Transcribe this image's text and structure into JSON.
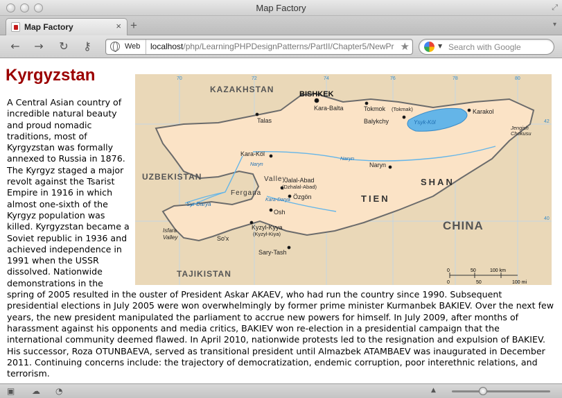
{
  "window": {
    "title": "Map Factory"
  },
  "tab": {
    "label": "Map Factory",
    "close": "×"
  },
  "toolbar": {
    "new_tab": "+",
    "tab_menu": "⌄",
    "back": "←",
    "forward": "→",
    "reload": "↻",
    "key": "⚷"
  },
  "urlbar": {
    "scheme_label": "Web",
    "host": "localhost",
    "path": "/php/LearningPHPDesignPatterns/PartII/Chapter5/NewPr"
  },
  "search": {
    "placeholder": "Search with Google"
  },
  "page": {
    "title": "Kyrgyzstan",
    "body": "A Central Asian country of incredible natural beauty and proud nomadic traditions, most of Kyrgyzstan was formally annexed to Russia in 1876. The Kyrgyz staged a major revolt against the Tsarist Empire in 1916 in which almost one-sixth of the Kyrgyz population was killed. Kyrgyzstan became a Soviet republic in 1936 and achieved independence in 1991 when the USSR dissolved. Nationwide demonstrations in the spring of 2005 resulted in the ouster of President Askar AKAEV, who had run the country since 1990. Subsequent presidential elections in July 2005 were won overwhelmingly by former prime minister Kurmanbek BAKIEV. Over the next few years, the new president manipulated the parliament to accrue new powers for himself. In July 2009, after months of harassment against his opponents and media critics, BAKIEV won re-election in a presidential campaign that the international community deemed flawed. In April 2010, nationwide protests led to the resignation and expulsion of BAKIEV. His successor, Roza OTUNBAEVA, served as transitional president until Almazbek ATAMBAEV was inaugurated in December 2011. Continuing concerns include: the trajectory of democratization, endemic corruption, poor interethnic relations, and terrorism."
  },
  "map": {
    "countries": {
      "kz": "KAZAKHSTAN",
      "uz": "UZBEKISTAN",
      "tj": "TAJIKISTAN",
      "cn": "CHINA"
    },
    "cities": {
      "bishkek": "BISHKEK",
      "karabalta": "Kara-Balta",
      "tokmok": "Tokmok",
      "tokmok_alt": "(Tokmak)",
      "balykchy": "Balykchy",
      "karakol": "Karakol",
      "talas": "Talas",
      "karakol2": "Kara-Köl",
      "naryn": "Naryn",
      "jalalabad": "Jalal-Abad",
      "jalalabad_alt": "(Dzhalal-Abad)",
      "ozgon": "Özgön",
      "osh": "Osh",
      "kyzylkyya": "Kyzyl-Kyya",
      "kyzylkyya_alt": "(Kyzyl-Kiya)",
      "sarytash": "Sary-Tash",
      "sox": "So'x",
      "isfara": "Isfara",
      "valley": "Valley"
    },
    "features": {
      "lake": "Ysyk-Köl",
      "naryn_river": "Naryn",
      "syr_darya": "Syr Darya",
      "kara_darya": "Kara-Darya",
      "fergana": "Fergana",
      "fergana_valley": "Valley",
      "tien": "TIEN",
      "shan": "SHAN",
      "peak1": "Jengish",
      "peak2": "Chokusu",
      "naryn_river2": "Naryn"
    },
    "grid": {
      "lon": [
        "70",
        "72",
        "74",
        "76",
        "78",
        "80"
      ],
      "lat": [
        "42",
        "40"
      ]
    },
    "scale": {
      "km": [
        "0",
        "50",
        "100 km"
      ],
      "mi": [
        "0",
        "50",
        "100 mi"
      ]
    },
    "colors": {
      "country": "#fbe3c6",
      "neighbor": "#ead8b8",
      "water": "#64b5e8",
      "border": "#6b6b6b"
    }
  },
  "status": {
    "zoom_level": 0.3
  }
}
